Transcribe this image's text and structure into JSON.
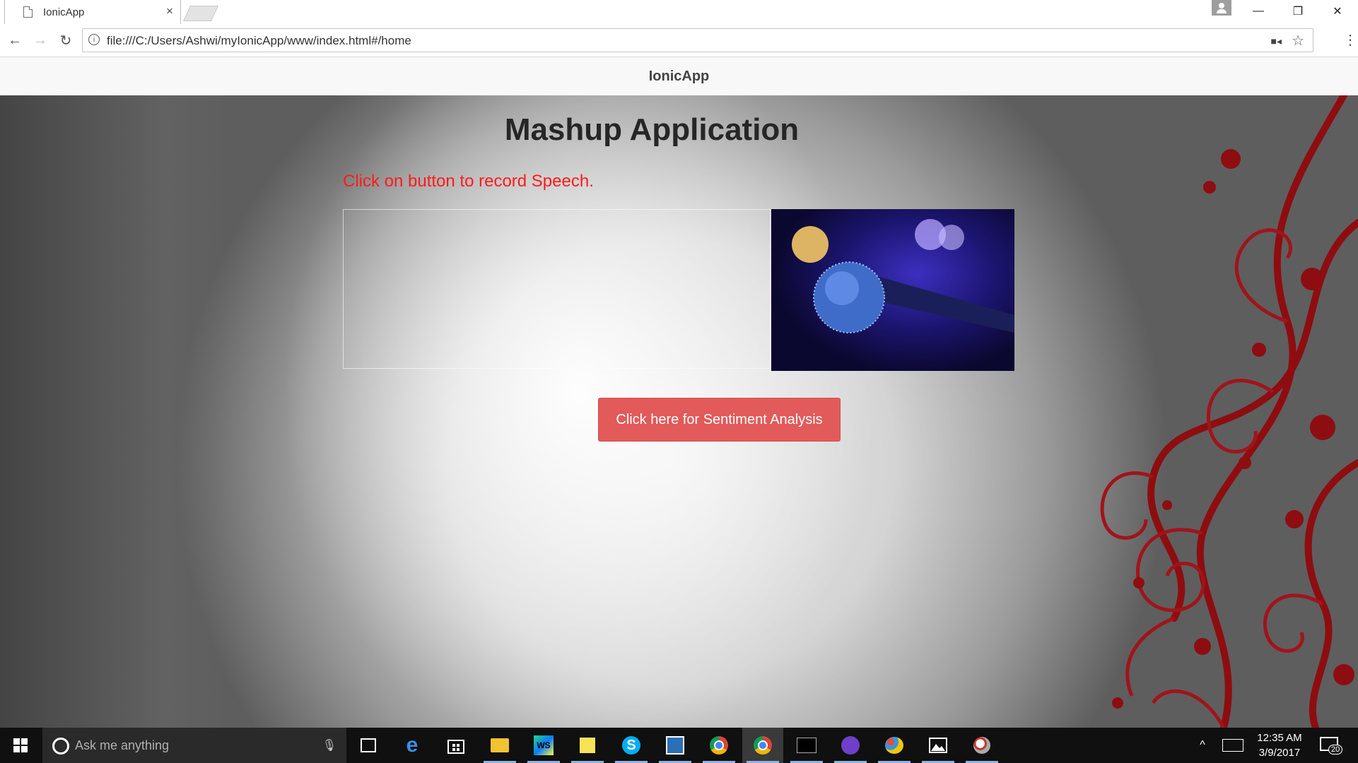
{
  "browser": {
    "tab_title": "IonicApp",
    "tab_close": "×",
    "url": "file:///C:/Users/Ashwi/myIonicApp/www/index.html#/home",
    "window_controls": {
      "minimize": "—",
      "restore": "❐",
      "close": "✕"
    },
    "nav": {
      "back": "←",
      "forward": "→",
      "reload": "↻",
      "menu": "⋮",
      "star": "☆",
      "info": "i"
    }
  },
  "app": {
    "header_title": "IonicApp",
    "page_title": "Mashup Application",
    "prompt": "Click on button to record Speech.",
    "sentiment_button": "Click here for Sentiment Analysis",
    "accent_color": "#e25a5a",
    "prompt_color": "#ff1a1a"
  },
  "taskbar": {
    "search_placeholder": "Ask me anything",
    "icons": [
      {
        "name": "task-view-icon"
      },
      {
        "name": "edge-icon"
      },
      {
        "name": "store-icon"
      },
      {
        "name": "file-explorer-icon"
      },
      {
        "name": "webstorm-icon",
        "text": "WS"
      },
      {
        "name": "sticky-notes-icon"
      },
      {
        "name": "skype-icon",
        "text": "S"
      },
      {
        "name": "app-icon"
      },
      {
        "name": "chrome-icon"
      },
      {
        "name": "chrome-icon"
      },
      {
        "name": "command-prompt-icon"
      },
      {
        "name": "github-icon"
      },
      {
        "name": "paint-icon"
      },
      {
        "name": "photos-icon"
      },
      {
        "name": "paint-alt-icon"
      }
    ],
    "clock": {
      "time": "12:35 AM",
      "date": "3/9/2017"
    },
    "notification_count": "20"
  }
}
